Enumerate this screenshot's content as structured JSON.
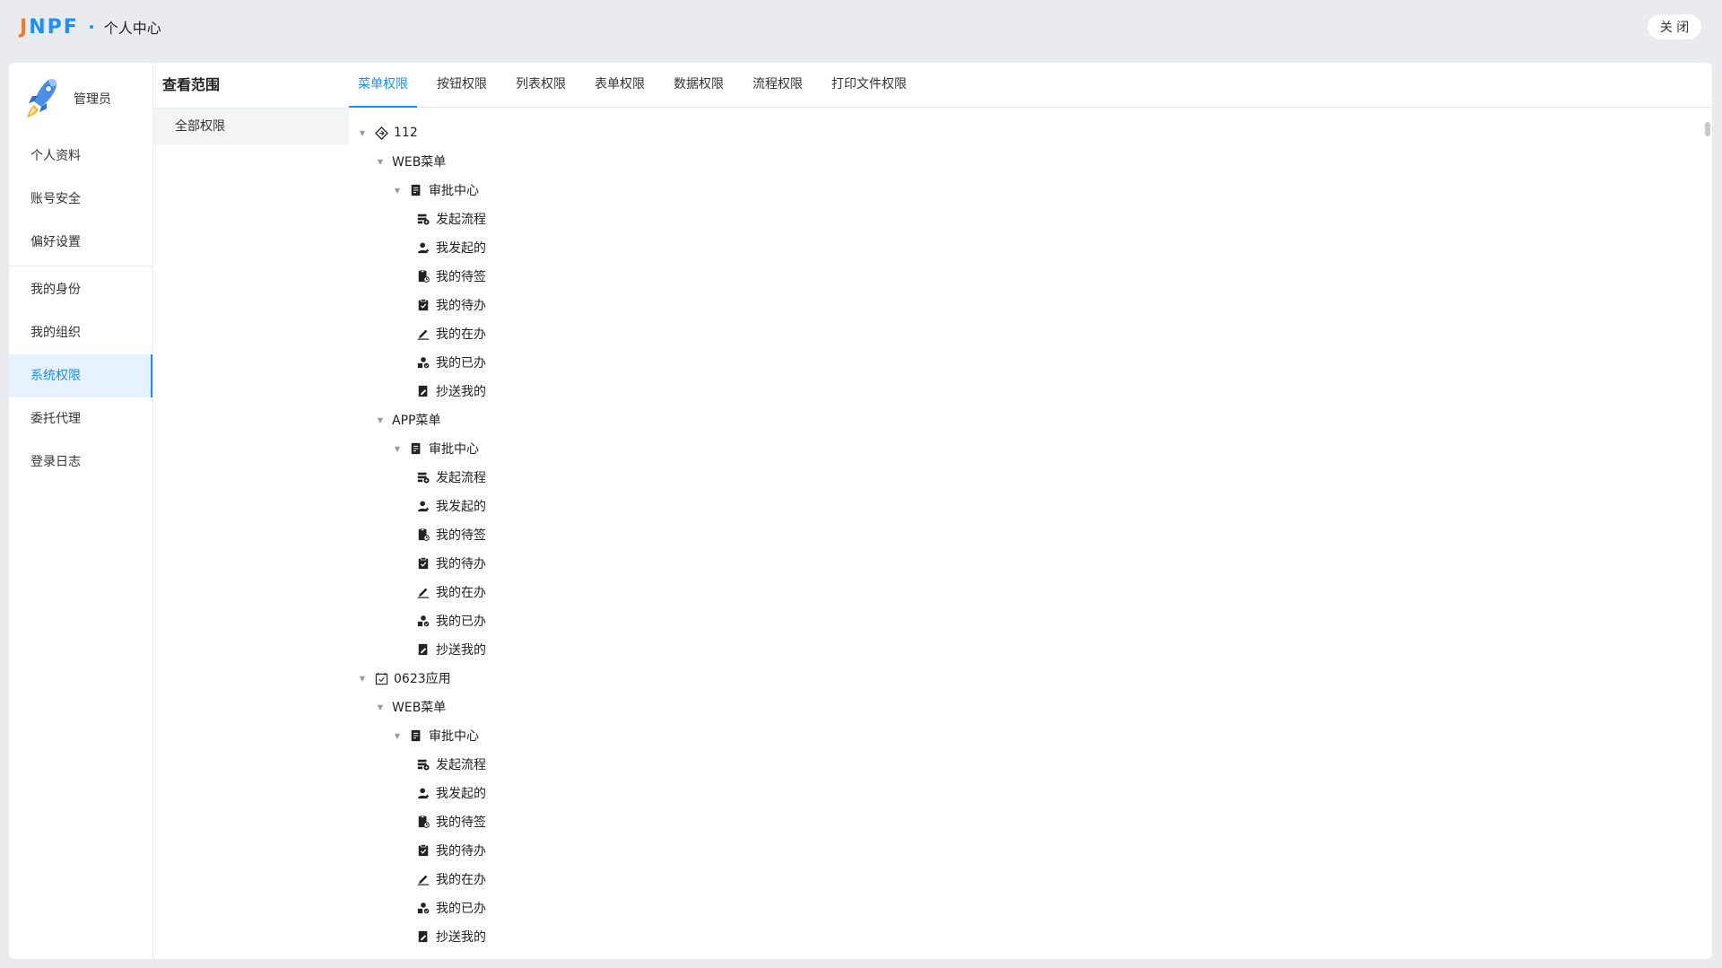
{
  "header": {
    "logo_j": "J",
    "logo_rest": "NPF",
    "title": "个人中心",
    "close_label": "关 闭"
  },
  "profile": {
    "name": "管理员"
  },
  "menu": [
    {
      "label": "个人资料",
      "name": "menu-item-profile"
    },
    {
      "label": "账号安全",
      "name": "menu-item-account-security"
    },
    {
      "label": "偏好设置",
      "name": "menu-item-preferences"
    },
    {
      "label": "我的身份",
      "name": "menu-item-identity"
    },
    {
      "label": "我的组织",
      "name": "menu-item-organization"
    },
    {
      "label": "系统权限",
      "name": "menu-item-system-permissions",
      "active": true
    },
    {
      "label": "委托代理",
      "name": "menu-item-delegation"
    },
    {
      "label": "登录日志",
      "name": "menu-item-login-log"
    }
  ],
  "scope": {
    "title": "查看范围",
    "items": [
      "全部权限"
    ]
  },
  "tabs": [
    {
      "label": "菜单权限",
      "active": true
    },
    {
      "label": "按钮权限"
    },
    {
      "label": "列表权限"
    },
    {
      "label": "表单权限"
    },
    {
      "label": "数据权限"
    },
    {
      "label": "流程权限"
    },
    {
      "label": "打印文件权限"
    }
  ],
  "colors": {
    "accent": "#1890ff",
    "logo_orange": "#f07a2c"
  },
  "tree": [
    {
      "level": 0,
      "label": "112",
      "icon": "diamond-icon",
      "expandable": true
    },
    {
      "level": 1,
      "label": "WEB菜单",
      "expandable": true
    },
    {
      "level": 2,
      "label": "审批中心",
      "icon": "document-icon",
      "expandable": true
    },
    {
      "level": 3,
      "label": "发起流程",
      "icon": "launch-flow-icon"
    },
    {
      "level": 3,
      "label": "我发起的",
      "icon": "user-icon"
    },
    {
      "level": 3,
      "label": "我的待签",
      "icon": "sign-icon"
    },
    {
      "level": 3,
      "label": "我的待办",
      "icon": "clipboard-check-icon"
    },
    {
      "level": 3,
      "label": "我的在办",
      "icon": "pencil-icon"
    },
    {
      "level": 3,
      "label": "我的已办",
      "icon": "shapes-icon"
    },
    {
      "level": 3,
      "label": "抄送我的",
      "icon": "edit-doc-icon"
    },
    {
      "level": 1,
      "label": "APP菜单",
      "expandable": true
    },
    {
      "level": 2,
      "label": "审批中心",
      "icon": "document-icon",
      "expandable": true
    },
    {
      "level": 3,
      "label": "发起流程",
      "icon": "launch-flow-icon"
    },
    {
      "level": 3,
      "label": "我发起的",
      "icon": "user-icon"
    },
    {
      "level": 3,
      "label": "我的待签",
      "icon": "sign-icon"
    },
    {
      "level": 3,
      "label": "我的待办",
      "icon": "clipboard-check-icon"
    },
    {
      "level": 3,
      "label": "我的在办",
      "icon": "pencil-icon"
    },
    {
      "level": 3,
      "label": "我的已办",
      "icon": "shapes-icon"
    },
    {
      "level": 3,
      "label": "抄送我的",
      "icon": "edit-doc-icon"
    },
    {
      "level": 0,
      "label": "0623应用",
      "icon": "calendar-check-icon",
      "expandable": true
    },
    {
      "level": 1,
      "label": "WEB菜单",
      "expandable": true
    },
    {
      "level": 2,
      "label": "审批中心",
      "icon": "document-icon",
      "expandable": true
    },
    {
      "level": 3,
      "label": "发起流程",
      "icon": "launch-flow-icon"
    },
    {
      "level": 3,
      "label": "我发起的",
      "icon": "user-icon"
    },
    {
      "level": 3,
      "label": "我的待签",
      "icon": "sign-icon"
    },
    {
      "level": 3,
      "label": "我的待办",
      "icon": "clipboard-check-icon"
    },
    {
      "level": 3,
      "label": "我的在办",
      "icon": "pencil-icon"
    },
    {
      "level": 3,
      "label": "我的已办",
      "icon": "shapes-icon"
    },
    {
      "level": 3,
      "label": "抄送我的",
      "icon": "edit-doc-icon"
    }
  ]
}
